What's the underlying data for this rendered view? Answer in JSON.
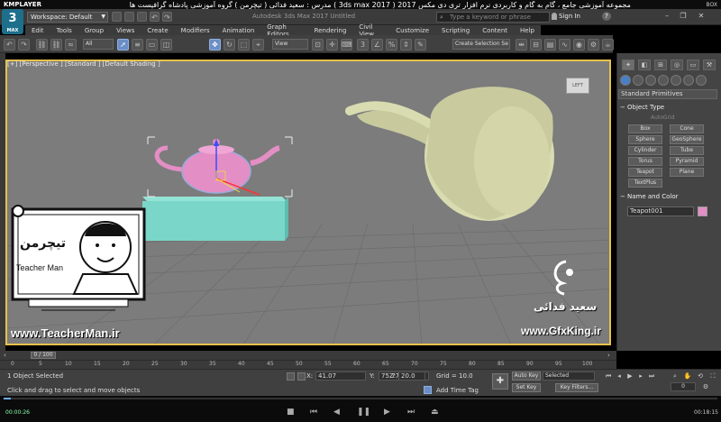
{
  "player": {
    "brand": "KMPLAYER",
    "title": "مجموعه آموزشی جامع ، گام به گام و کاربردی نرم افزار تری دی مکس 2017 ( 3ds max 2017 ) مدرس : سعید فدائی ( تیچرمن ) گروه آموزشی پادشاه گرافیست ها",
    "box_label": "BOX",
    "time_elapsed": "00:00:26",
    "time_total": "00:18:15",
    "progress_pct": 1
  },
  "app": {
    "button_label": "3",
    "button_sub": "MAX",
    "workspace_label": "Workspace: Default",
    "window_caption": "Autodesk 3ds Max 2017   Untitled",
    "search_placeholder": "Type a keyword or phrase",
    "sign_in": "Sign In",
    "help": "?"
  },
  "menu": [
    "Edit",
    "Tools",
    "Group",
    "Views",
    "Create",
    "Modifiers",
    "Animation",
    "Graph Editors",
    "Rendering",
    "Civil View",
    "Customize",
    "Scripting",
    "Content",
    "Help"
  ],
  "toolbar": {
    "filter": "All",
    "ref_coord": "View",
    "named_selection": "Create Selection Se"
  },
  "viewport": {
    "label": "[+] [Perspective ] [Standard ] [Default Shading ]",
    "viewcube_label": "LEFT"
  },
  "command_panel": {
    "category": "Standard Primitives",
    "object_type_title": "Object Type",
    "autogrid": "AutoGrid",
    "buttons": [
      "Box",
      "Cone",
      "Sphere",
      "GeoSphere",
      "Cylinder",
      "Tube",
      "Torus",
      "Pyramid",
      "Teapot",
      "Plane",
      "TextPlus"
    ],
    "name_color_title": "Name and Color",
    "object_name": "Teapot001",
    "object_color": "#e38ec4"
  },
  "timeline": {
    "frame_display": "0 / 100",
    "ticks": [
      "0",
      "5",
      "10",
      "15",
      "20",
      "25",
      "30",
      "35",
      "40",
      "45",
      "50",
      "55",
      "60",
      "65",
      "70",
      "75",
      "80",
      "85",
      "90",
      "95",
      "100"
    ]
  },
  "status": {
    "selection": "1 Object Selected",
    "prompt": "Click and drag to select and move objects",
    "x_label": "X:",
    "x_value": "41.07",
    "y_label": "Y:",
    "y_value": "75.773",
    "z_label": "Z:",
    "z_value": "20.0",
    "grid": "Grid = 10.0",
    "add_time_tag": "Add Time Tag",
    "auto_key": "Auto Key",
    "set_key": "Set Key",
    "key_filters": "Key Filters...",
    "selected_dd": "Selected",
    "current_frame": "0"
  },
  "overlay": {
    "teacher_logo_text": "تیچرمن",
    "teacher_name": "Teacher Man",
    "teacher_url": "www.TeacherMan.ir",
    "gfx_name": "سعید فدائی",
    "gfx_url": "www.GfxKing.ir"
  },
  "colors": {
    "viewport_bg": "#7c7c7c",
    "viewport_border": "#e8c14a",
    "teapot_small": "#e38ec4",
    "box": "#79d6c8",
    "teapot_large": "#d9dcb0",
    "accent_blue": "#6b8ec7"
  }
}
